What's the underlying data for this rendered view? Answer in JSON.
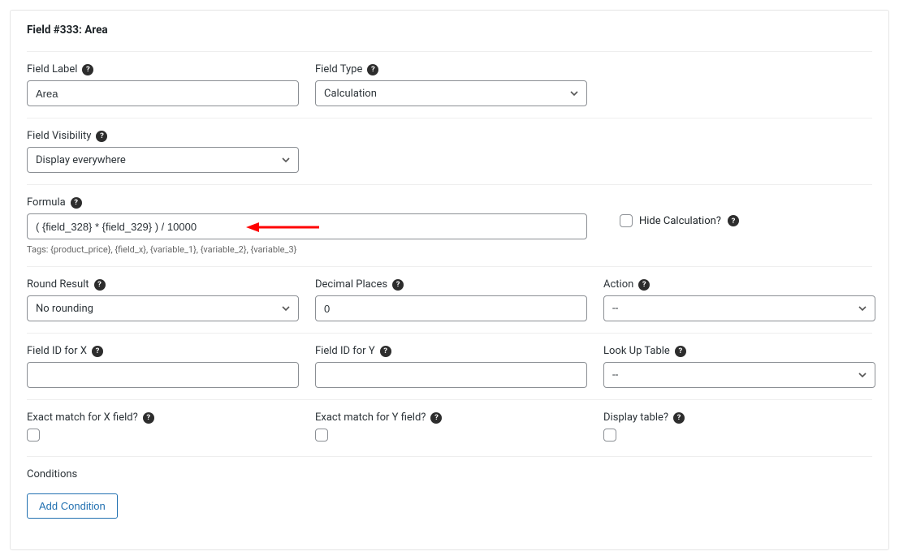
{
  "panel": {
    "title": "Field #333: Area"
  },
  "labels": {
    "field_label": "Field Label",
    "field_type": "Field Type",
    "field_visibility": "Field Visibility",
    "formula": "Formula",
    "hide_calculation": "Hide Calculation?",
    "round_result": "Round Result",
    "decimal_places": "Decimal Places",
    "action": "Action",
    "field_id_x": "Field ID for X",
    "field_id_y": "Field ID for Y",
    "lookup_table": "Look Up Table",
    "exact_match_x": "Exact match for X field?",
    "exact_match_y": "Exact match for Y field?",
    "display_table": "Display table?",
    "conditions": "Conditions",
    "add_condition": "Add Condition"
  },
  "values": {
    "field_label": "Area",
    "field_type": "Calculation",
    "field_visibility": "Display everywhere",
    "formula": "( {field_328} * {field_329} ) / 10000",
    "round_result": "No rounding",
    "decimal_places": "0",
    "action": "--",
    "field_id_x": "",
    "field_id_y": "",
    "lookup_table": "--"
  },
  "helper": {
    "formula_tags": "Tags: {product_price}, {field_x}, {variable_1}, {variable_2}, {variable_3}"
  }
}
